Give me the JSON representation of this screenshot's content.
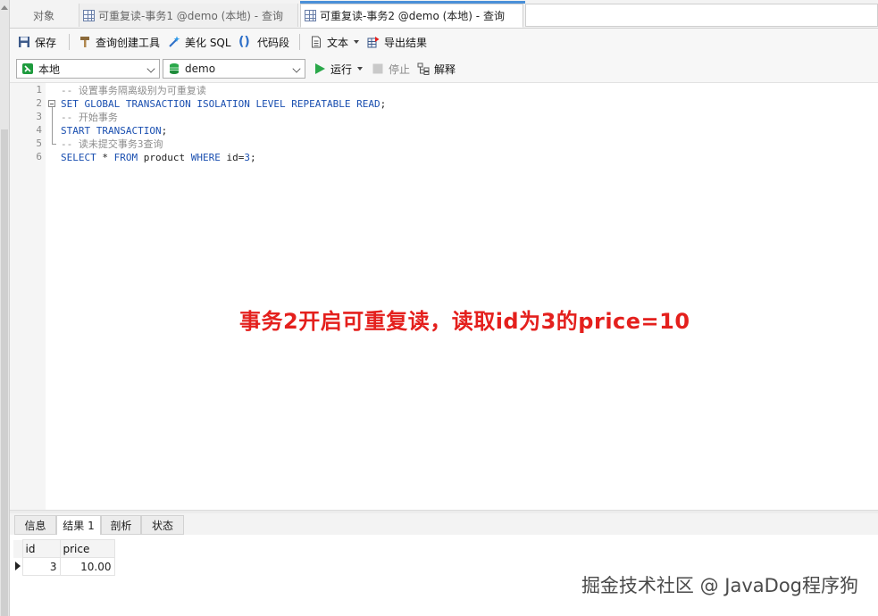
{
  "tabs": {
    "objects": "对象",
    "query1": "可重复读-事务1 @demo (本地) - 查询",
    "query2": "可重复读-事务2 @demo (本地) - 查询"
  },
  "toolbar": {
    "save": "保存",
    "query_builder": "查询创建工具",
    "beautify_sql": "美化 SQL",
    "code_snippet": "代码段",
    "text": "文本",
    "export_results": "导出结果"
  },
  "connection": {
    "server": "本地",
    "database": "demo",
    "run": "运行",
    "stop": "停止",
    "explain": "解释"
  },
  "editor": {
    "line_numbers": [
      "1",
      "2",
      "3",
      "4",
      "5",
      "6"
    ],
    "line1": "-- 设置事务隔离级别为可重复读",
    "line2_kw": "SET GLOBAL TRANSACTION ISOLATION LEVEL REPEATABLE READ",
    "line2_end": ";",
    "line3": "-- 开始事务",
    "line4_kw": "START TRANSACTION",
    "line4_end": ";",
    "line5": "-- 读未提交事务3查询",
    "line6": {
      "select": "SELECT",
      "star": " * ",
      "from": "FROM",
      "table": " product ",
      "where": "WHERE",
      "cond": " id=",
      "num": "3",
      "end": ";"
    }
  },
  "annotation": "事务2开启可重复读，读取id为3的price=10",
  "result_tabs": [
    "信息",
    "结果 1",
    "剖析",
    "状态"
  ],
  "results": {
    "columns": [
      "id",
      "price"
    ],
    "rows": [
      [
        "3",
        "10.00"
      ]
    ]
  },
  "watermark": "掘金技术社区 @ JavaDog程序狗",
  "colors": {
    "annotation": "#e4201d",
    "keyword": "#1a4fb0",
    "comment": "#8d8d8d",
    "active_tab_accent": "#4a90d9"
  }
}
